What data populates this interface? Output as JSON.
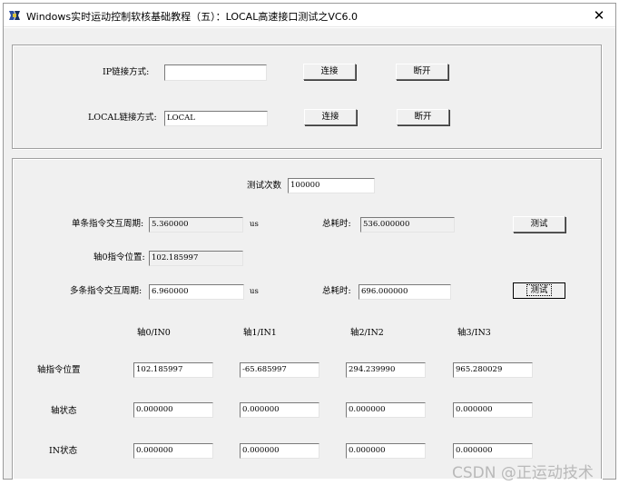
{
  "window": {
    "title": "Windows实时运动控制软核基础教程（五）：LOCAL高速接口测试之VC6.0",
    "close_glyph": "✕"
  },
  "connection": {
    "ip_label": "IP链接方式:",
    "ip_value": "",
    "local_label": "LOCAL链接方式:",
    "local_value": "LOCAL",
    "connect_label": "连接",
    "disconnect_label": "断开"
  },
  "test": {
    "count_label": "测试次数",
    "count_value": "100000",
    "single_label": "单条指令交互周期:",
    "single_value": "5.360000",
    "unit": "us",
    "total_label": "总耗时:",
    "single_total_value": "536.000000",
    "test_button": "测试",
    "axis0_pos_label": "轴0指令位置:",
    "axis0_pos_value": "102.185997",
    "multi_label": "多条指令交互周期:",
    "multi_value": "6.960000",
    "multi_total_value": "696.000000"
  },
  "axes": {
    "headers": [
      "轴0/IN0",
      "轴1/IN1",
      "轴2/IN2",
      "轴3/IN3"
    ],
    "rows": [
      {
        "label": "轴指令位置",
        "values": [
          "102.185997",
          "-65.685997",
          "294.239990",
          "965.280029"
        ]
      },
      {
        "label": "轴状态",
        "values": [
          "0.000000",
          "0.000000",
          "0.000000",
          "0.000000"
        ]
      },
      {
        "label": "IN状态",
        "values": [
          "0.000000",
          "0.000000",
          "0.000000",
          "0.000000"
        ]
      }
    ]
  },
  "watermark": "CSDN @正运动技术",
  "colors": {
    "dialog_bg": "#f0f0f0",
    "watermark": "#b9b9b9"
  },
  "icons": {
    "app": "app-icon",
    "close": "close-icon"
  }
}
